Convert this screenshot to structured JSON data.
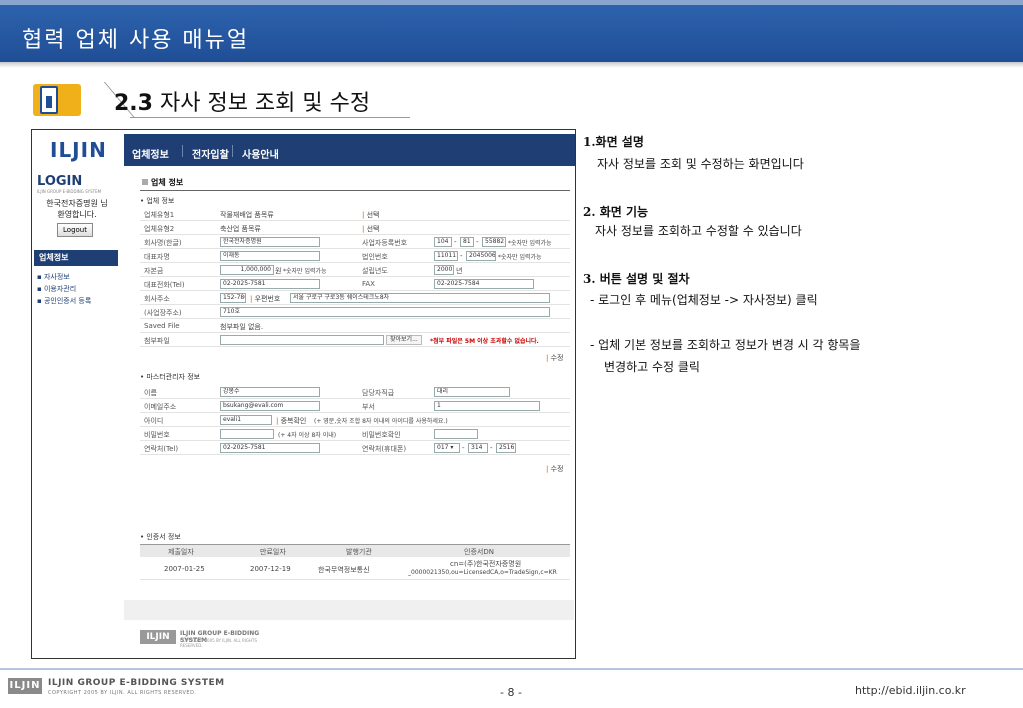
{
  "banner": {
    "title": "협력 업체 사용 매뉴얼"
  },
  "section": {
    "number": "2.3",
    "title": "자사 정보 조회 및 수정"
  },
  "screen": {
    "logo": "ILJIN",
    "nav": [
      "업체정보",
      "전자입찰",
      "사용안내"
    ],
    "login": {
      "title": "LOGIN",
      "subtitle": "ILJIN GROUP E-BIDDING SYSTEM",
      "user": "한국전자증명원 님",
      "welcome": "환영합니다.",
      "logout": "Logout"
    },
    "sidebar": {
      "head": "업체정보",
      "items": [
        "자사정보",
        "이용자관리",
        "공인인증서 등록"
      ]
    },
    "content_title": "업체 정보",
    "company_label": "• 업체 정보",
    "company": {
      "type1_label": "업체유형1",
      "type1_value": "작물재배업 품목류",
      "select": "선택",
      "type2_label": "업체유형2",
      "type2_value": "축산업 품목류",
      "name_label": "회사명(한글)",
      "name_value": "한국전자증명원",
      "bizno_label": "사업자등록번호",
      "bizno_1": "104",
      "bizno_2": "81",
      "bizno_3": "55882",
      "bizno_hint": "*숫자만 입력가능",
      "ceo_label": "대표자명",
      "ceo_value": "이재동",
      "corpno_label": "법인번호",
      "corpno_1": "110111",
      "corpno_2": "2045006",
      "corpno_hint": "*숫자만 입력가능",
      "capital_label": "자본금",
      "capital_value": "1,000,000",
      "capital_unit": "원",
      "capital_hint": "*숫자만 입력가능",
      "year_label": "설립년도",
      "year_value": "2000",
      "year_unit": "년",
      "tel_label": "대표전화(Tel)",
      "tel_value": "02-2025-7581",
      "fax_label": "FAX",
      "fax_value": "02-2025-7584",
      "addr_label": "회사주소",
      "zip_value": "152-780",
      "zip_button": "우편번호",
      "addr_value": "서울 구로구 구로3동 쉐이스테크노8차",
      "addr2_label": "(사업장주소)",
      "addr2_value": "710호",
      "saved_label": "Saved File",
      "saved_value": "첨부파일 없음.",
      "attach_label": "첨부파일",
      "browse": "찾아보기...",
      "attach_warn": "*첨부 파일은 5M 이상 초과할수 없습니다.",
      "edit": "수정"
    },
    "master_label": "• 마스터관리자 정보",
    "master": {
      "name_label": "이름",
      "name_value": "강봉수",
      "title_label": "담당자직급",
      "title_value": "대리",
      "email_label": "이메일주소",
      "email_value": "bsukang@evali.com",
      "dept_label": "부서",
      "dept_value": "1",
      "id_label": "아이디",
      "id_value": "evali1",
      "id_check": "중복확인",
      "id_hint": "(+ 영문,숫자 조합 8자 이내의 아이디를 사용하세요.)",
      "pw_label": "비밀번호",
      "pw_hint": "(+ 4자 이상 8자 이내)",
      "pw2_label": "비밀번호확인",
      "tel_label": "연락처(Tel)",
      "tel_value": "02-2025-7581",
      "mobile_label": "연락처(휴대폰)",
      "mobile_1": "017",
      "mobile_2": "314",
      "mobile_3": "2516",
      "edit": "수정"
    },
    "cert_label": "• 인증서 정보",
    "cert": {
      "headers": [
        "제출일자",
        "만료일자",
        "발행기관",
        "인증서DN"
      ],
      "row": [
        "2007-01-25",
        "2007-12-19",
        "한국무역정보통신",
        "cn=(주)한국전자증명원",
        "_0000021350,ou=LicensedCA,o=TradeSign,c=KR"
      ]
    },
    "footer": {
      "logo": "ILJIN",
      "brand": "ILJIN GROUP E-BIDDING SYSTEM",
      "copy": "COPYRIGHT 2005 BY ILJIN. ALL RIGHTS RESERVED."
    }
  },
  "description": {
    "h1": "1.화면 설명",
    "p1": "자사 정보를 조회 및 수정하는 화면입니다",
    "h2": "2. 화면 기능",
    "p2": "자사 정보를 조회하고  수정할 수 있습니다",
    "h3": "3. 버튼 설명 및 절차",
    "p3": "- 로그인 후 메뉴(업체정보 -> 자사정보) 클릭",
    "p4": "- 업체 기본 정보를 조회하고 정보가 변경 시 각 항목을",
    "p5": "변경하고 수정  클릭"
  },
  "bottom": {
    "logo": "ILJIN",
    "brand": "ILJIN GROUP E-BIDDING SYSTEM",
    "copy": "COPYRIGHT 2005 BY ILJIN. ALL RIGHTS RESERVED.",
    "page": "- 8 -",
    "url": "http://ebid.iljin.co.kr"
  }
}
